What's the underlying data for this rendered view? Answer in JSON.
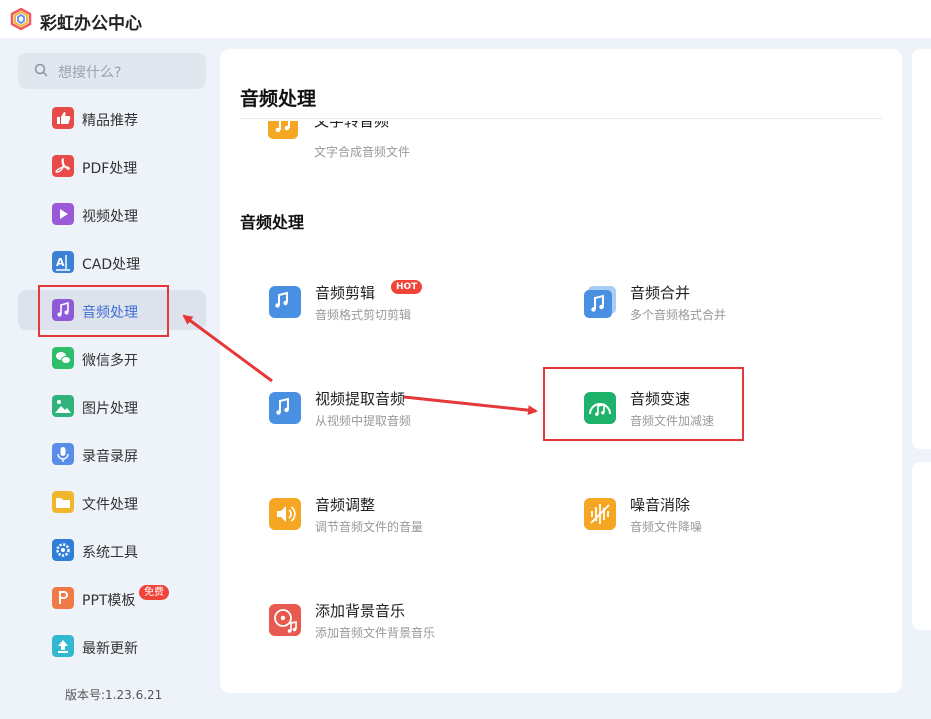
{
  "app": {
    "title": "彩虹办公中心"
  },
  "search": {
    "placeholder": "想搜什么?"
  },
  "sidebar": {
    "items": [
      {
        "label": "精品推荐",
        "icon": "thumbs-up-icon",
        "color": "#e84a4a"
      },
      {
        "label": "PDF处理",
        "icon": "pdf-icon",
        "color": "#e84a4a"
      },
      {
        "label": "视频处理",
        "icon": "video-play-icon",
        "color": "#9b59d8"
      },
      {
        "label": "CAD处理",
        "icon": "cad-icon",
        "color": "#3b82d6"
      },
      {
        "label": "音频处理",
        "icon": "music-note-icon",
        "color": "#8e5ad8"
      },
      {
        "label": "微信多开",
        "icon": "wechat-icon",
        "color": "#2fbf6c"
      },
      {
        "label": "图片处理",
        "icon": "image-icon",
        "color": "#2fb37b"
      },
      {
        "label": "录音录屏",
        "icon": "microphone-icon",
        "color": "#5b8de8"
      },
      {
        "label": "文件处理",
        "icon": "folder-icon",
        "color": "#f2b62c"
      },
      {
        "label": "系统工具",
        "icon": "gear-icon",
        "color": "#2f7fd8"
      },
      {
        "label": "PPT模板",
        "icon": "ppt-icon",
        "color": "#f07a45",
        "badge": "免费"
      },
      {
        "label": "最新更新",
        "icon": "upload-icon",
        "color": "#34b8d0"
      }
    ],
    "active_index": 4,
    "version": "版本号:1.23.6.21"
  },
  "main": {
    "page_title": "音频处理",
    "clipped_item": {
      "name": "文字转音频",
      "desc": "文字合成音频文件"
    },
    "section_title": "音频处理",
    "tools": [
      {
        "name": "音频剪辑",
        "desc": "音频格式剪切剪辑",
        "badge": "HOT",
        "icon": "audio-cut-icon",
        "color": "#4a90e2"
      },
      {
        "name": "音频合并",
        "desc": "多个音频格式合并",
        "icon": "audio-merge-icon",
        "color": "#4a90e2"
      },
      {
        "name": "视频提取音频",
        "desc": "从视频中提取音频",
        "icon": "audio-extract-icon",
        "color": "#4a90e2"
      },
      {
        "name": "音频变速",
        "desc": "音频文件加减速",
        "icon": "speed-gauge-icon",
        "color": "#1fb26b"
      },
      {
        "name": "音频调整",
        "desc": "调节音频文件的音量",
        "icon": "speaker-icon",
        "color": "#f5a623"
      },
      {
        "name": "噪音消除",
        "desc": "音频文件降噪",
        "icon": "noise-reduce-icon",
        "color": "#f5a623"
      },
      {
        "name": "添加背景音乐",
        "desc": "添加音频文件背景音乐",
        "icon": "bg-music-icon",
        "color": "#e85a4f"
      }
    ]
  },
  "annotation_color": "#e6373a"
}
